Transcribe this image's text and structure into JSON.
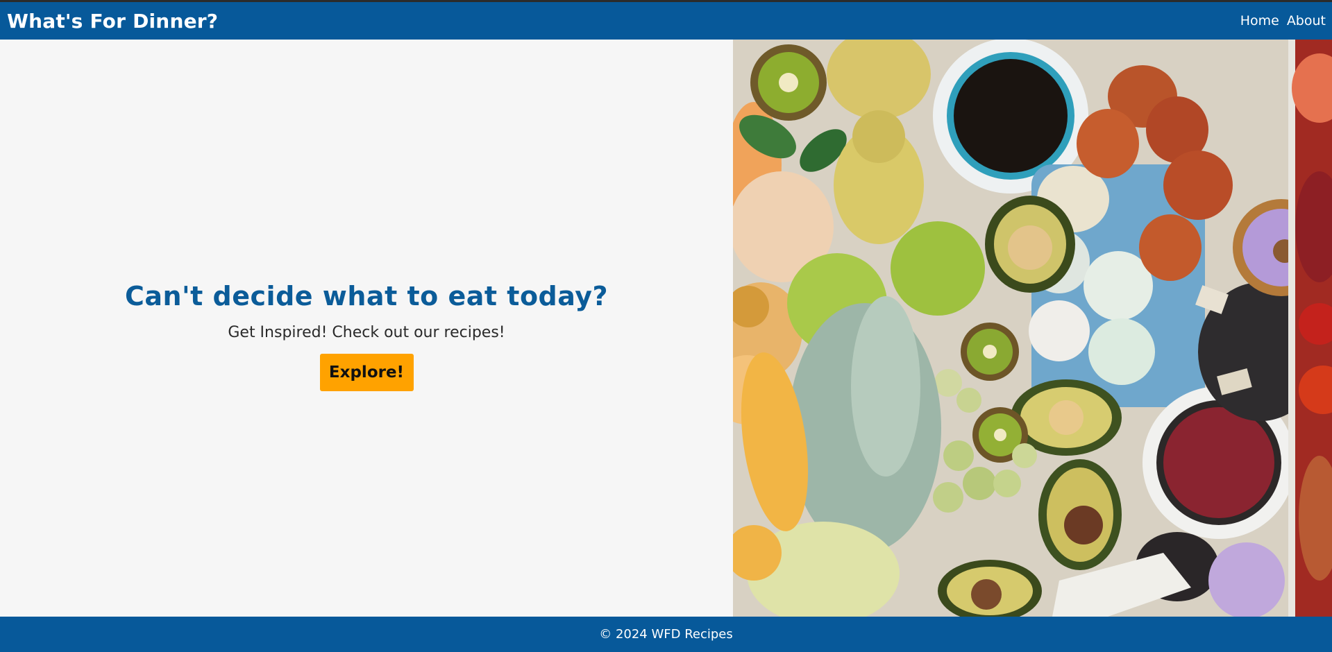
{
  "header": {
    "brand": "What's For Dinner?",
    "nav": [
      {
        "label": "Home"
      },
      {
        "label": "About"
      }
    ]
  },
  "hero": {
    "title": "Can't decide what to eat today?",
    "subtitle": "Get Inspired! Check out our recipes!",
    "button_label": "Explore!",
    "image_icon": "food-spread-photo"
  },
  "footer": {
    "copyright": "© 2024 WFD Recipes"
  },
  "colors": {
    "brand_blue": "#07599a",
    "title_blue": "#0b5c99",
    "button_orange": "#ffa200",
    "page_bg": "#f6f6f6"
  }
}
